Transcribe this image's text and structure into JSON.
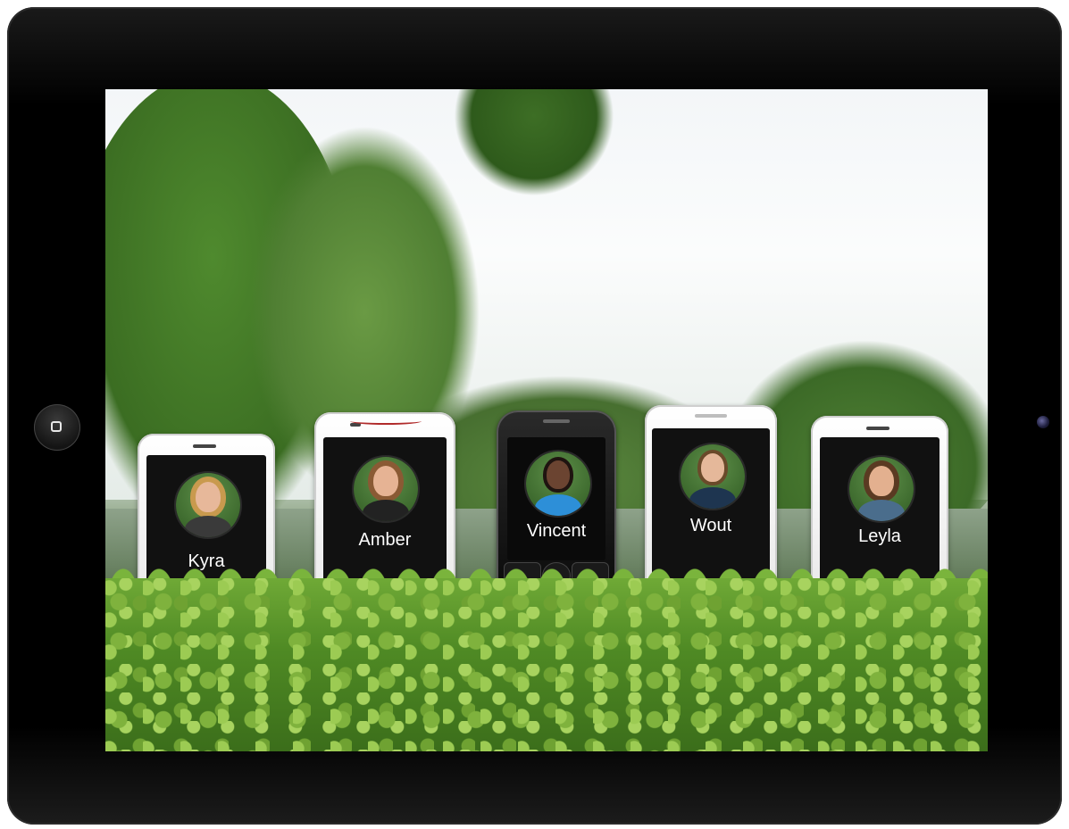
{
  "contacts": [
    {
      "name": "Kyra"
    },
    {
      "name": "Amber"
    },
    {
      "name": "Vincent"
    },
    {
      "name": "Wout"
    },
    {
      "name": "Leyla"
    }
  ],
  "colors": {
    "bezel": "#000000",
    "phone_display": "#111111",
    "name_text": "#ffffff",
    "hedge": "#4f8a24"
  },
  "icons": {
    "home_button": "home-button-icon",
    "camera": "front-camera-icon"
  }
}
